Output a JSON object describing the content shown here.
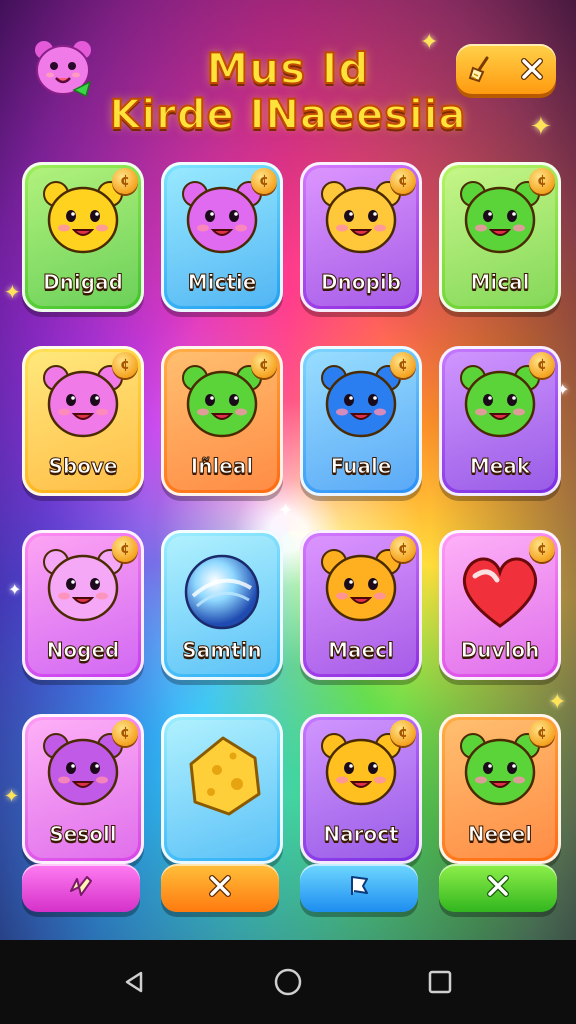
{
  "header": {
    "title_line1": "Mus Id",
    "title_line2": "Kirde INaeesiia"
  },
  "cards": [
    {
      "label": "Dnigad",
      "theme": "green"
    },
    {
      "label": "Mictie",
      "theme": "blue"
    },
    {
      "label": "Dnopib",
      "theme": "purple"
    },
    {
      "label": "Mical",
      "theme": "lime"
    },
    {
      "label": "Sbove",
      "theme": "yellow"
    },
    {
      "label": "Iñleal",
      "theme": "orange"
    },
    {
      "label": "Fuale",
      "theme": "sky"
    },
    {
      "label": "Meak",
      "theme": "violet"
    },
    {
      "label": "Noged",
      "theme": "magenta"
    },
    {
      "label": "Samtin",
      "theme": "cyan"
    },
    {
      "label": "Maecl",
      "theme": "purple"
    },
    {
      "label": "Duvloh",
      "theme": "pink"
    },
    {
      "label": "Sesoll",
      "theme": "pink"
    },
    {
      "label": "",
      "theme": "cyan"
    },
    {
      "label": "Naroct",
      "theme": "violet"
    },
    {
      "label": "Neeel",
      "theme": "orange"
    }
  ],
  "bottom_buttons": [
    {
      "icon": "lightning-icon",
      "color": "#e23ad6"
    },
    {
      "icon": "close-icon",
      "color": "#ff8a16"
    },
    {
      "icon": "flag-icon",
      "color": "#2a9ff5"
    },
    {
      "icon": "close-icon",
      "color": "#3cc424"
    }
  ],
  "top_controls": {
    "icons": [
      "broom-icon",
      "close-icon"
    ]
  },
  "system_nav": {
    "icons": [
      "back-icon",
      "home-icon",
      "recents-icon"
    ]
  }
}
